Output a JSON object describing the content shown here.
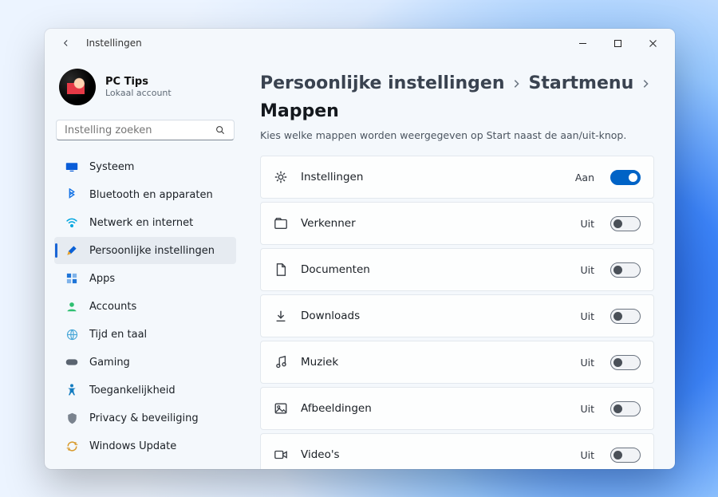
{
  "window": {
    "title": "Instellingen"
  },
  "profile": {
    "name": "PC Tips",
    "sub": "Lokaal account"
  },
  "search": {
    "placeholder": "Instelling zoeken"
  },
  "nav": {
    "items": [
      {
        "id": "systeem",
        "label": "Systeem",
        "iconColor": "#0a5dd8"
      },
      {
        "id": "bluetooth",
        "label": "Bluetooth en apparaten",
        "iconColor": "#1473e6"
      },
      {
        "id": "netwerk",
        "label": "Netwerk en internet",
        "iconColor": "#00a6e0"
      },
      {
        "id": "persoonlijk",
        "label": "Persoonlijke instellingen",
        "iconColor": "#0b61d6",
        "active": true
      },
      {
        "id": "apps",
        "label": "Apps",
        "iconColor": "#1f75d8"
      },
      {
        "id": "accounts",
        "label": "Accounts",
        "iconColor": "#2fbf71"
      },
      {
        "id": "tijd",
        "label": "Tijd en taal",
        "iconColor": "#4aa8d8"
      },
      {
        "id": "gaming",
        "label": "Gaming",
        "iconColor": "#5a6470"
      },
      {
        "id": "toegankelijkheid",
        "label": "Toegankelijkheid",
        "iconColor": "#147cc0"
      },
      {
        "id": "privacy",
        "label": "Privacy & beveiliging",
        "iconColor": "#7a838e"
      },
      {
        "id": "update",
        "label": "Windows Update",
        "iconColor": "#d89a2b"
      }
    ]
  },
  "breadcrumb": {
    "level1": "Persoonlijke instellingen",
    "level2": "Startmenu",
    "level3": "Mappen"
  },
  "description": "Kies welke mappen worden weergegeven op Start naast de aan/uit-knop.",
  "toggle_labels": {
    "on": "Aan",
    "off": "Uit"
  },
  "folders": [
    {
      "id": "instellingen",
      "label": "Instellingen",
      "on": true
    },
    {
      "id": "verkenner",
      "label": "Verkenner",
      "on": false
    },
    {
      "id": "documenten",
      "label": "Documenten",
      "on": false
    },
    {
      "id": "downloads",
      "label": "Downloads",
      "on": false
    },
    {
      "id": "muziek",
      "label": "Muziek",
      "on": false
    },
    {
      "id": "afbeeldingen",
      "label": "Afbeeldingen",
      "on": false
    },
    {
      "id": "videos",
      "label": "Video's",
      "on": false
    }
  ]
}
